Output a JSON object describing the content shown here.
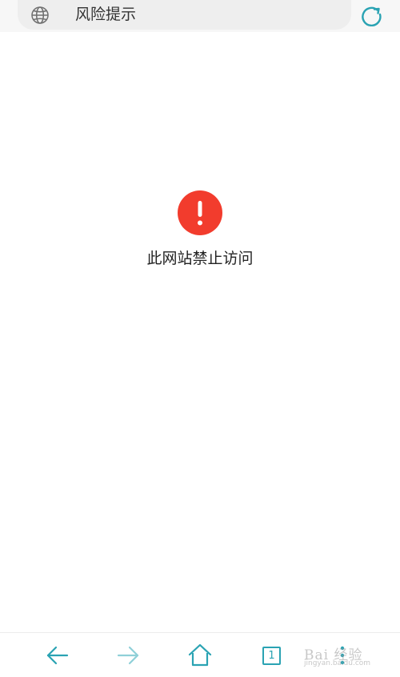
{
  "address_bar": {
    "title": "风险提示",
    "globe_icon": "globe-icon",
    "refresh_icon": "refresh-icon"
  },
  "page": {
    "warning_icon": "exclamation-icon",
    "message": "此网站禁止访问"
  },
  "bottom_nav": {
    "back_icon": "back-arrow-icon",
    "forward_icon": "forward-arrow-icon",
    "home_icon": "home-icon",
    "tab_count": "1",
    "menu_icon": "menu-icon"
  },
  "watermark": {
    "text": "Bai 经验",
    "url": "jingyan.baidu.com"
  },
  "colors": {
    "accent": "#2aa3b3",
    "warning": "#f23c2d",
    "text": "#222222"
  }
}
